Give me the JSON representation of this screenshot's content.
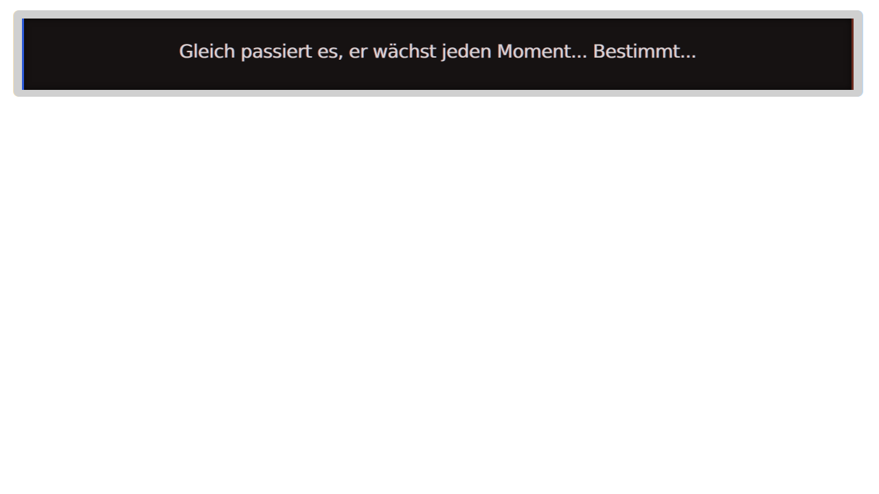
{
  "dialog": {
    "text": "Gleich passiert es, er wächst jeden Moment... Bestimmt..."
  },
  "colors": {
    "frame": "#d0d0d0",
    "panel": "#161212",
    "text": "#d9d2d2"
  }
}
